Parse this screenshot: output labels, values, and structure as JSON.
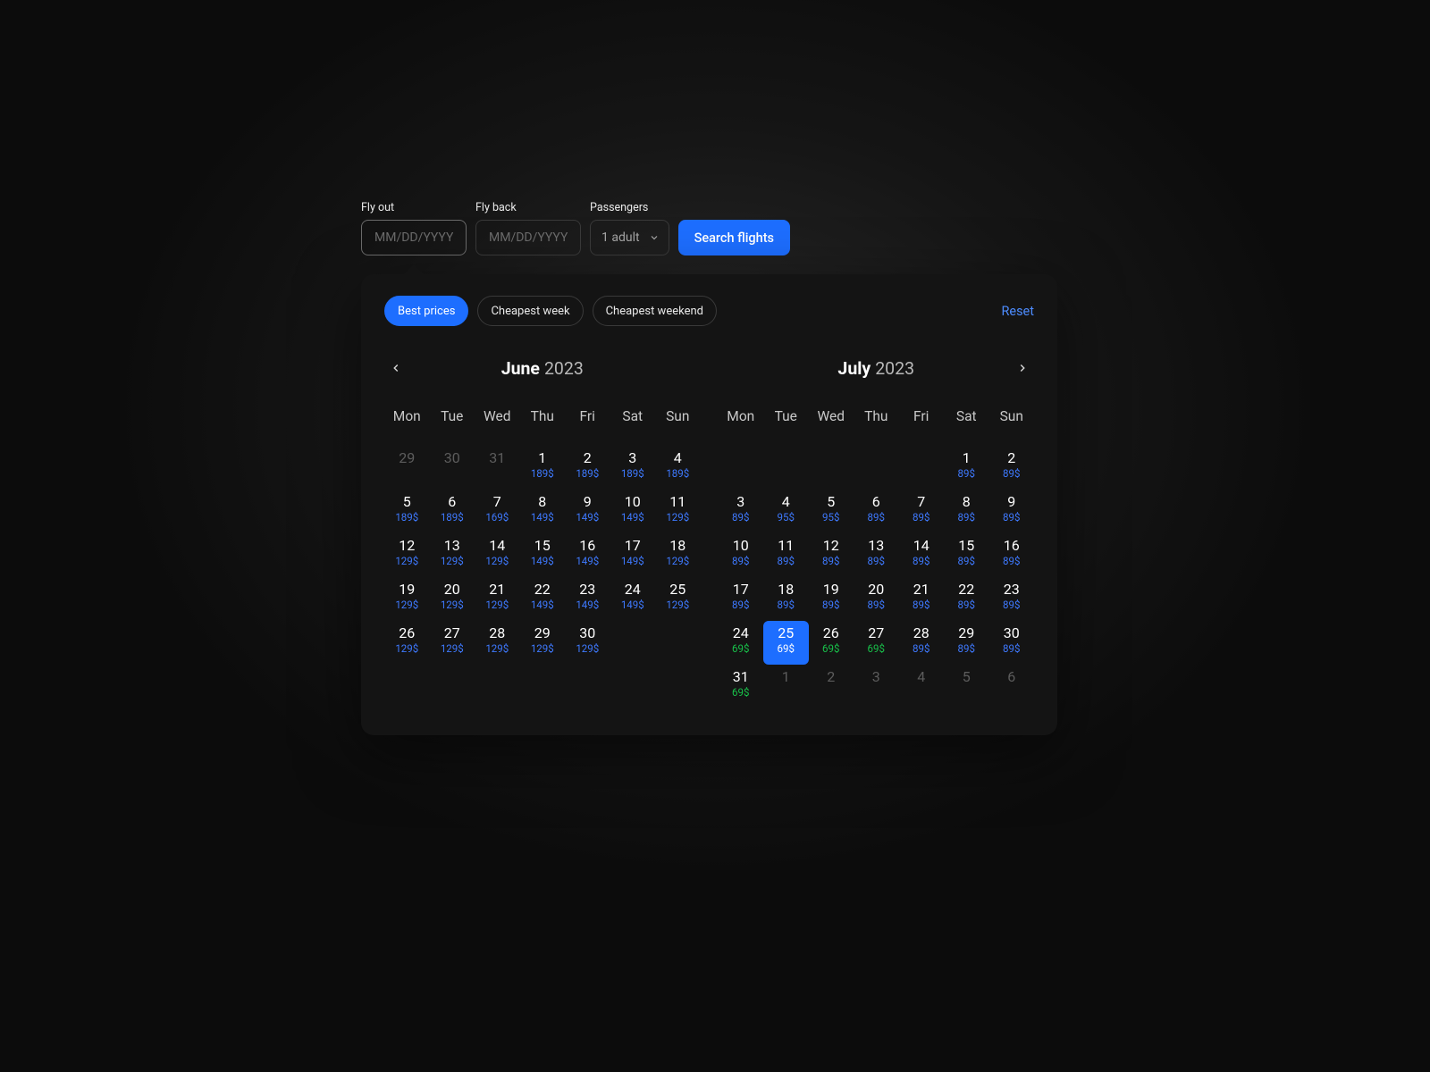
{
  "search": {
    "fly_out_label": "Fly out",
    "fly_out_placeholder": "MM/DD/YYYY",
    "fly_back_label": "Fly back",
    "fly_back_placeholder": "MM/DD/YYYY",
    "passengers_label": "Passengers",
    "passengers_value": "1 adult",
    "search_button": "Search flights"
  },
  "panel": {
    "chips": {
      "best_prices": "Best prices",
      "cheapest_week": "Cheapest week",
      "cheapest_weekend": "Cheapest weekend"
    },
    "reset": "Reset"
  },
  "calendar": {
    "dow": [
      "Mon",
      "Tue",
      "Wed",
      "Thu",
      "Fri",
      "Sat",
      "Sun"
    ],
    "months": [
      {
        "name": "June",
        "year": "2023",
        "days": [
          {
            "num": "29",
            "other": true
          },
          {
            "num": "30",
            "other": true
          },
          {
            "num": "31",
            "other": true
          },
          {
            "num": "1",
            "price": "189$"
          },
          {
            "num": "2",
            "price": "189$"
          },
          {
            "num": "3",
            "price": "189$"
          },
          {
            "num": "4",
            "price": "189$"
          },
          {
            "num": "5",
            "price": "189$"
          },
          {
            "num": "6",
            "price": "189$"
          },
          {
            "num": "7",
            "price": "169$"
          },
          {
            "num": "8",
            "price": "149$"
          },
          {
            "num": "9",
            "price": "149$"
          },
          {
            "num": "10",
            "price": "149$"
          },
          {
            "num": "11",
            "price": "129$"
          },
          {
            "num": "12",
            "price": "129$"
          },
          {
            "num": "13",
            "price": "129$"
          },
          {
            "num": "14",
            "price": "129$"
          },
          {
            "num": "15",
            "price": "149$"
          },
          {
            "num": "16",
            "price": "149$"
          },
          {
            "num": "17",
            "price": "149$"
          },
          {
            "num": "18",
            "price": "129$"
          },
          {
            "num": "19",
            "price": "129$"
          },
          {
            "num": "20",
            "price": "129$"
          },
          {
            "num": "21",
            "price": "129$"
          },
          {
            "num": "22",
            "price": "149$"
          },
          {
            "num": "23",
            "price": "149$"
          },
          {
            "num": "24",
            "price": "149$"
          },
          {
            "num": "25",
            "price": "129$"
          },
          {
            "num": "26",
            "price": "129$"
          },
          {
            "num": "27",
            "price": "129$"
          },
          {
            "num": "28",
            "price": "129$"
          },
          {
            "num": "29",
            "price": "129$"
          },
          {
            "num": "30",
            "price": "129$"
          }
        ]
      },
      {
        "name": "July",
        "year": "2023",
        "lead_blank": 5,
        "days": [
          {
            "num": "1",
            "price": "89$"
          },
          {
            "num": "2",
            "price": "89$"
          },
          {
            "num": "3",
            "price": "89$"
          },
          {
            "num": "4",
            "price": "95$"
          },
          {
            "num": "5",
            "price": "95$"
          },
          {
            "num": "6",
            "price": "89$"
          },
          {
            "num": "7",
            "price": "89$"
          },
          {
            "num": "8",
            "price": "89$"
          },
          {
            "num": "9",
            "price": "89$"
          },
          {
            "num": "10",
            "price": "89$"
          },
          {
            "num": "11",
            "price": "89$"
          },
          {
            "num": "12",
            "price": "89$"
          },
          {
            "num": "13",
            "price": "89$"
          },
          {
            "num": "14",
            "price": "89$"
          },
          {
            "num": "15",
            "price": "89$"
          },
          {
            "num": "16",
            "price": "89$"
          },
          {
            "num": "17",
            "price": "89$"
          },
          {
            "num": "18",
            "price": "89$"
          },
          {
            "num": "19",
            "price": "89$"
          },
          {
            "num": "20",
            "price": "89$"
          },
          {
            "num": "21",
            "price": "89$"
          },
          {
            "num": "22",
            "price": "89$"
          },
          {
            "num": "23",
            "price": "89$"
          },
          {
            "num": "24",
            "price": "69$",
            "green": true
          },
          {
            "num": "25",
            "price": "69$",
            "green": true,
            "selected": true
          },
          {
            "num": "26",
            "price": "69$",
            "green": true
          },
          {
            "num": "27",
            "price": "69$",
            "green": true
          },
          {
            "num": "28",
            "price": "89$"
          },
          {
            "num": "29",
            "price": "89$"
          },
          {
            "num": "30",
            "price": "89$"
          },
          {
            "num": "31",
            "price": "69$",
            "green": true
          },
          {
            "num": "1",
            "other": true
          },
          {
            "num": "2",
            "other": true
          },
          {
            "num": "3",
            "other": true
          },
          {
            "num": "4",
            "other": true
          },
          {
            "num": "5",
            "other": true
          },
          {
            "num": "6",
            "other": true
          }
        ]
      }
    ]
  }
}
